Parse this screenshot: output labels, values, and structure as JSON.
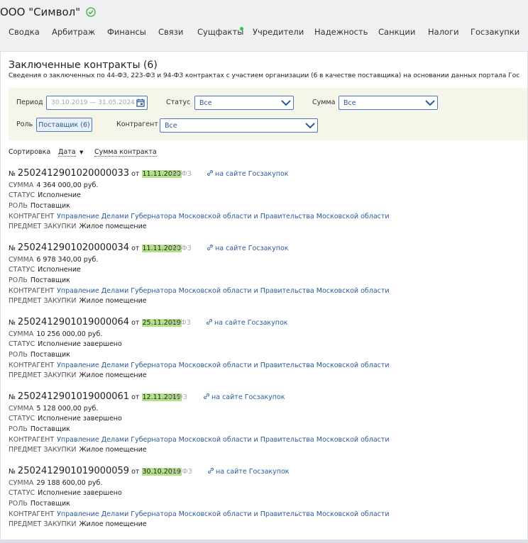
{
  "company": {
    "name": "ООО \"Символ\""
  },
  "nav": [
    {
      "label": "Сводка"
    },
    {
      "label": "Арбитраж"
    },
    {
      "label": "Финансы"
    },
    {
      "label": "Связи"
    },
    {
      "label": "Сущфакты"
    },
    {
      "label": "Учредители"
    },
    {
      "label": "Надежность"
    },
    {
      "label": "Санкции"
    },
    {
      "label": "Налоги"
    },
    {
      "label": "Госзакупки"
    }
  ],
  "section": {
    "title": "Заключенные контракты (6)",
    "subtitle": "Сведения о заключенных по 44-ФЗ, 223-ФЗ и 94-ФЗ контрактах с участием организации (6 в качестве поставщика) на основании данных портала Гос"
  },
  "filters": {
    "period_label": "Период",
    "period_value": "30.10.2019 — 31.05.2024",
    "status_label": "Статус",
    "status_value": "Все",
    "sum_label": "Сумма",
    "sum_value": "Все",
    "role_label": "Роль",
    "role_value": "Поставщик (6)",
    "counterparty_label": "Контрагент",
    "counterparty_value": "Все"
  },
  "sort": {
    "label": "Сортировка",
    "options": [
      "Дата",
      "Сумма контракта"
    ],
    "arrow": "▼"
  },
  "labels": {
    "no": "№",
    "from": "от",
    "sum": "СУММА",
    "status": "СТАТУС",
    "role": "РОЛЬ",
    "counterparty": "КОНТРАГЕНТ",
    "subject": "ПРЕДМЕТ ЗАКУПКИ",
    "gov_link": "на сайте Госзакупок"
  },
  "contracts": [
    {
      "number": "2502412901020000033",
      "date": "11.11.2020",
      "law": "44-ФЗ",
      "sum": "4 364 000,00 руб.",
      "status": "Исполнение",
      "role": "Поставщик",
      "counterparty": "Управление Делами Губернатора Московской области и Правительства Московской области",
      "subject": "Жилое помещение"
    },
    {
      "number": "2502412901020000034",
      "date": "11.11.2020",
      "law": "44-ФЗ",
      "sum": "6 978 340,00 руб.",
      "status": "Исполнение",
      "role": "Поставщик",
      "counterparty": "Управление Делами Губернатора Московской области и Правительства Московской области",
      "subject": "Жилое помещение"
    },
    {
      "number": "2502412901019000064",
      "date": "25.11.2019",
      "law": "44-ФЗ",
      "sum": "10 256 000,00 руб.",
      "status": "Исполнение завершено",
      "role": "Поставщик",
      "counterparty": "Управление Делами Губернатора Московской области и Правительства Московской области",
      "subject": "Жилое помещение"
    },
    {
      "number": "2502412901019000061",
      "date": "12.11.2019",
      "law": "44-ФЗ",
      "sum": "5 128 000,00 руб.",
      "status": "Исполнение завершено",
      "role": "Поставщик",
      "counterparty": "Управление Делами Губернатора Московской области и Правительства Московской области",
      "subject": "Жилое помещение"
    },
    {
      "number": "2502412901019000059",
      "date": "30.10.2019",
      "law": "44-ФЗ",
      "sum": "29 188 600,00 руб.",
      "status": "Исполнение завершено",
      "role": "Поставщик",
      "counterparty": "Управление Делами Губернатора Московской области и Правительства Московской области",
      "subject": "Жилое помещение"
    }
  ],
  "colors": {
    "accent": "#2a5a9a",
    "date_highlight": "#b5e08a",
    "filter_bg": "#f6f5e9",
    "check": "#3cb043",
    "dot": "#2ecc40"
  }
}
